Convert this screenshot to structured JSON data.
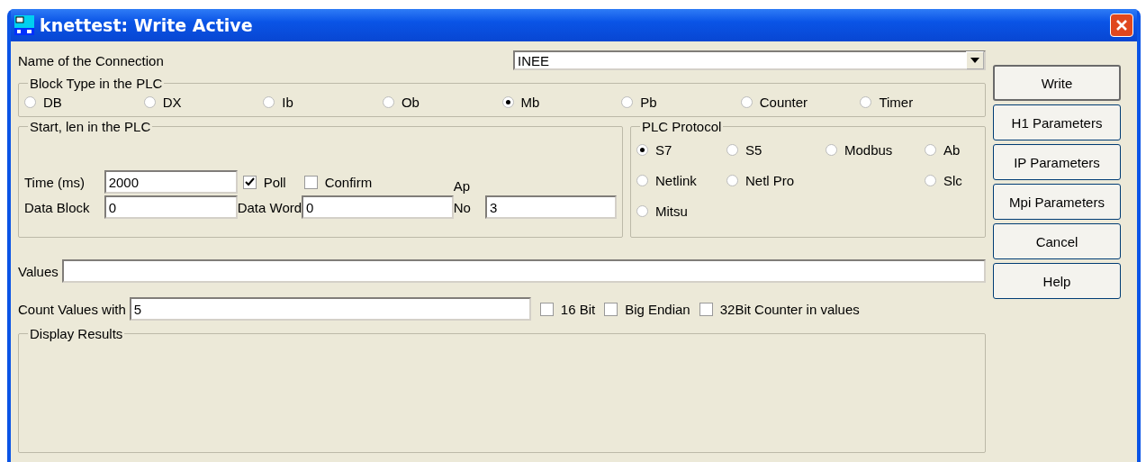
{
  "window": {
    "title": "knettest: Write Active"
  },
  "connection": {
    "label": "Name of the Connection",
    "value": "INEE"
  },
  "block_type": {
    "title": "Block Type in the PLC",
    "options": [
      {
        "label": "DB",
        "selected": false
      },
      {
        "label": "DX",
        "selected": false
      },
      {
        "label": "Ib",
        "selected": false
      },
      {
        "label": "Ob",
        "selected": false
      },
      {
        "label": "Mb",
        "selected": true
      },
      {
        "label": "Pb",
        "selected": false
      },
      {
        "label": "Counter",
        "selected": false
      },
      {
        "label": "Timer",
        "selected": false
      }
    ]
  },
  "start_len": {
    "title": "Start, len in the PLC",
    "time": {
      "label": "Time (ms)",
      "value": "2000"
    },
    "poll": {
      "label": "Poll",
      "checked": true
    },
    "confirm": {
      "label": "Confirm",
      "checked": false
    },
    "ap_label": "Ap",
    "data_block": {
      "label": "Data Block",
      "value": "0"
    },
    "data_word": {
      "label": "Data Word",
      "value": "0"
    },
    "no": {
      "label": "No",
      "value": "3"
    }
  },
  "protocol": {
    "title": "PLC Protocol",
    "options": [
      {
        "label": "S7",
        "selected": true
      },
      {
        "label": "S5",
        "selected": false
      },
      {
        "label": "Modbus",
        "selected": false
      },
      {
        "label": "Ab",
        "selected": false
      },
      {
        "label": "Netlink",
        "selected": false
      },
      {
        "label": "Netl Pro",
        "selected": false
      },
      {
        "label": "Slc",
        "selected": false
      },
      {
        "label": "Mitsu",
        "selected": false
      }
    ]
  },
  "values": {
    "label": "Values"
  },
  "count": {
    "label": "Count Values with",
    "value": "5"
  },
  "count_options": [
    {
      "label": "16 Bit",
      "checked": false
    },
    {
      "label": "Big Endian",
      "checked": false
    },
    {
      "label": "32Bit Counter in values",
      "checked": false
    }
  ],
  "display_results": {
    "title": "Display Results"
  },
  "buttons": [
    "Write",
    "H1 Parameters",
    "IP Parameters",
    "Mpi Parameters",
    "Cancel",
    "Help"
  ]
}
